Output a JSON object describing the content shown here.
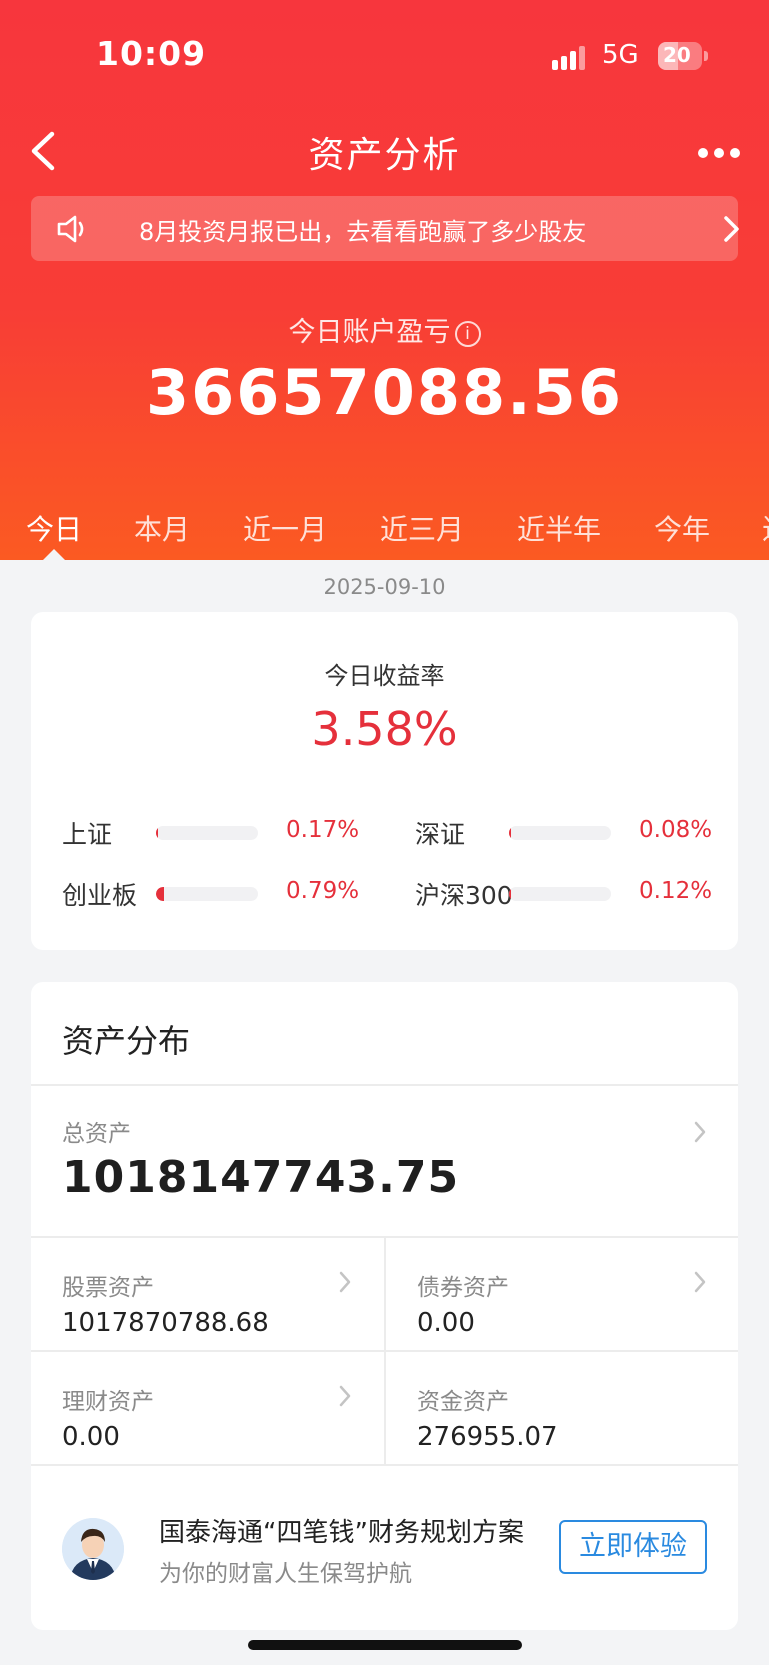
{
  "status_bar": {
    "time": "10:09",
    "network": "5G",
    "battery": "20"
  },
  "header": {
    "title": "资产分析",
    "back_icon": "chevron-left-icon",
    "more_icon": "more-dots-icon"
  },
  "notice": {
    "text": "8月投资月报已出，去看看跑赢了多少股友",
    "icon": "speaker-icon"
  },
  "pnl": {
    "label": "今日账户盈亏",
    "value": "36657088.56",
    "info_icon": "info-icon",
    "info_glyph": "i"
  },
  "tabs": [
    "今日",
    "本月",
    "近一月",
    "近三月",
    "近半年",
    "今年",
    "近"
  ],
  "active_tab": "今日",
  "date": "2025-09-10",
  "return_card": {
    "label": "今日收益率",
    "value": "3.58%",
    "indices": [
      {
        "name": "上证",
        "pct": "0.17%",
        "level": 0.17
      },
      {
        "name": "深证",
        "pct": "0.08%",
        "level": 0.08
      },
      {
        "name": "创业板",
        "pct": "0.79%",
        "level": 0.79
      },
      {
        "name": "沪深300",
        "pct": "0.12%",
        "level": 0.12
      }
    ]
  },
  "assets": {
    "title": "资产分布",
    "total_label": "总资产",
    "total_value": "1018147743.75",
    "stock_label": "股票资产",
    "stock_value": "1017870788.68",
    "bond_label": "债券资产",
    "bond_value": "0.00",
    "wealth_label": "理财资产",
    "wealth_value": "0.00",
    "cash_label": "资金资产",
    "cash_value": "276955.07"
  },
  "promo": {
    "title": "国泰海通“四笔钱”财务规划方案",
    "subtitle": "为你的财富人生保驾护航",
    "button": "立即体验"
  },
  "colors": {
    "brand_red": "#f7363d",
    "gain_red": "#e5303b",
    "link_blue": "#2a8ae0"
  }
}
